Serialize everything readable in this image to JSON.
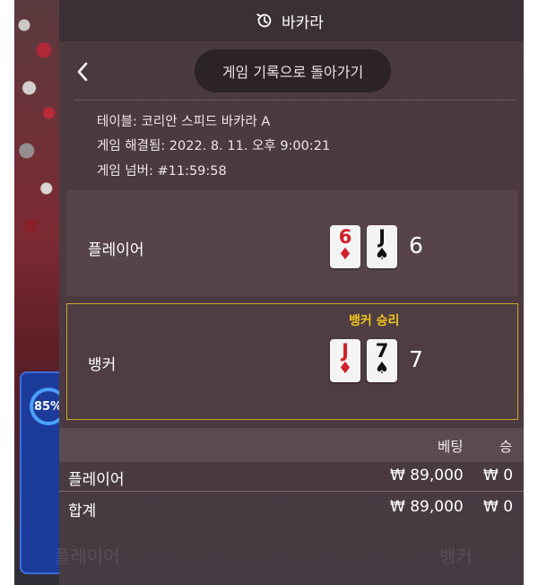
{
  "header": {
    "title": "바카라",
    "history_icon": "history-icon"
  },
  "nav": {
    "back_icon": "chevron-left-icon",
    "back_to_history_label": "게임 기록으로 돌아가기"
  },
  "info": {
    "table": "테이블: 코리안 스피드 바카라 A",
    "resolved": "게임 해결됨: 2022. 8. 11. 오후 9:00:21",
    "number": "게임 넘버: #11:59:58"
  },
  "hands": {
    "player": {
      "label": "플레이어",
      "cards": [
        {
          "rank": "6",
          "suit": "♦",
          "color": "red"
        },
        {
          "rank": "J",
          "suit": "♠",
          "color": "black"
        }
      ],
      "score": "6"
    },
    "banker": {
      "label": "뱅커",
      "result": "뱅커 승리",
      "cards": [
        {
          "rank": "J",
          "suit": "♦",
          "color": "red"
        },
        {
          "rank": "7",
          "suit": "♠",
          "color": "black"
        }
      ],
      "score": "7"
    }
  },
  "bets": {
    "columns": [
      "베팅",
      "승"
    ],
    "rows": [
      {
        "name": "플레이어",
        "bet": "₩ 89,000",
        "win": "₩ 0"
      }
    ],
    "total": {
      "name": "합계",
      "bet": "₩ 89,000",
      "win": "₩ 0"
    }
  },
  "background": {
    "percent": "85%",
    "ghost_left": "플레이어",
    "ghost_right": "뱅커"
  },
  "colors": {
    "panel": "#4a3b40",
    "win_gold": "#f1c51b",
    "banker_border": "#c9a92c",
    "red_suit": "#d0202a"
  }
}
